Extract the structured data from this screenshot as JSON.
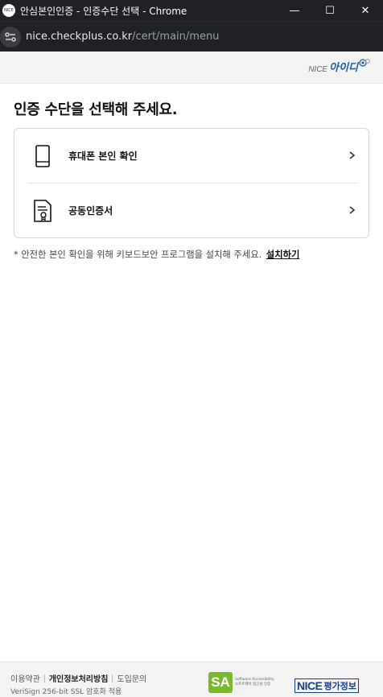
{
  "window": {
    "title": "안심본인인증 - 인증수단 선택 - Chrome",
    "app_icon_text": "NICE",
    "minimize": "—",
    "maximize": "☐",
    "close": "✕"
  },
  "address": {
    "host": "nice.checkplus.co.kr",
    "path": "/cert/main/menu"
  },
  "header": {
    "logo_nice": "NICE",
    "logo_id": "아이디"
  },
  "main": {
    "title": "인증 수단을 선택해 주세요.",
    "options": [
      {
        "label": "휴대폰 본인 확인",
        "icon": "mobile-phone-icon"
      },
      {
        "label": "공동인증서",
        "icon": "certificate-icon"
      }
    ],
    "notice_text": "* 안전한 본인 확인을 위해 키보드보안 프로그램을 설치해 주세요.",
    "install_link": "설치하기"
  },
  "footer": {
    "links": [
      "이용약관",
      "개인정보처리방침",
      "도입문의"
    ],
    "ssl_text": "VeriSign 256-bit SSL 암호화 적용",
    "sa_mark": "SA",
    "sa_line1": "Software Accessibility",
    "sa_line2": "소프트웨어 접근성 인증",
    "nice_brand": "NICE",
    "nice_brand_kr": "평가정보"
  },
  "colors": {
    "titlebar": "#202124",
    "brand_blue": "#1e5aa8",
    "sa_green": "#79b82f",
    "nice_navy": "#1c3f84"
  }
}
